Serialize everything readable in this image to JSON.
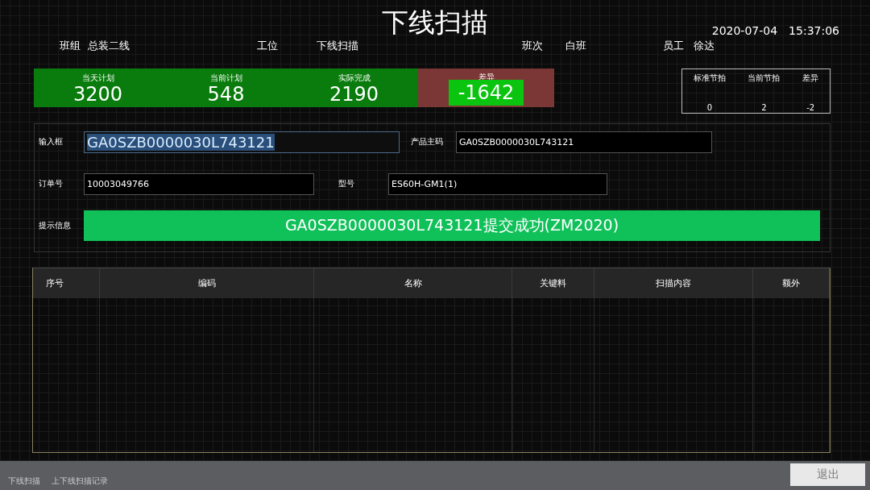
{
  "title": "下线扫描",
  "datetime": {
    "date": "2020-07-04",
    "time": "15:37:06"
  },
  "info": [
    {
      "label": "班组",
      "value": "总装二线"
    },
    {
      "label": "工位",
      "value": "下线扫描"
    },
    {
      "label": "班次",
      "value": "白班"
    },
    {
      "label": "员工",
      "value": "徐达"
    }
  ],
  "stats": [
    {
      "label": "当天计划",
      "value": "3200",
      "kind": "plain"
    },
    {
      "label": "当前计划",
      "value": "548",
      "kind": "plain"
    },
    {
      "label": "实际完成",
      "value": "2190",
      "kind": "plain"
    },
    {
      "label": "差异",
      "value": "-1642",
      "kind": "alert"
    }
  ],
  "takt": [
    {
      "label": "标准节拍",
      "value": "0"
    },
    {
      "label": "当前节拍",
      "value": "2"
    },
    {
      "label": "差异",
      "value": "-2"
    }
  ],
  "form": {
    "input": {
      "label": "输入框",
      "value": "GA0SZB0000030L743121",
      "text_selected": true
    },
    "product_code": {
      "label": "产品主码",
      "value": "GA0SZB0000030L743121"
    },
    "order_no": {
      "label": "订单号",
      "value": "10003049766"
    },
    "model": {
      "label": "型号",
      "value": "ES60H-GM1(1)"
    },
    "message": {
      "label": "提示信息",
      "value": "GA0SZB0000030L743121提交成功(ZM2020)"
    }
  },
  "table": {
    "columns": [
      "序号",
      "编码",
      "名称",
      "关键料",
      "扫描内容",
      "额外"
    ]
  },
  "taskbar": [
    {
      "label": "下线扫描"
    },
    {
      "label": "上下线扫描记录"
    }
  ],
  "exit_button": "退出"
}
